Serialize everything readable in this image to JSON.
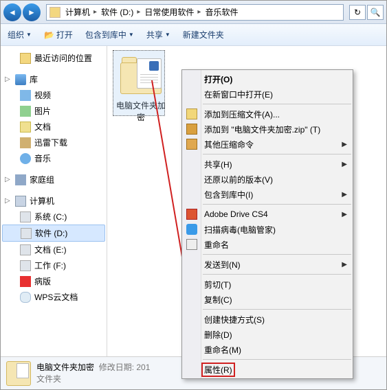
{
  "nav": {
    "crumbs": [
      "计算机",
      "软件 (D:)",
      "日常使用软件",
      "音乐软件"
    ]
  },
  "toolbar": {
    "organize": "组织",
    "open": "打开",
    "include": "包含到库中",
    "share": "共享",
    "newfolder": "新建文件夹"
  },
  "sidebar": {
    "recent": "最近访问的位置",
    "library": "库",
    "video": "视频",
    "pictures": "图片",
    "documents": "文档",
    "download": "迅雷下载",
    "music": "音乐",
    "homegroup": "家庭组",
    "computer": "计算机",
    "sys": "系统 (C:)",
    "soft": "软件 (D:)",
    "doc2": "文档 (E:)",
    "work": "工作 (F:)",
    "redacted": "病版",
    "wps": "WPS云文档"
  },
  "file": {
    "name": "电脑文件夹加密"
  },
  "ctx": {
    "open": "打开(O)",
    "newwin": "在新窗口中打开(E)",
    "addcomp": "添加到压缩文件(A)...",
    "addzip": "添加到 \"电脑文件夹加密.zip\" (T)",
    "otherzip": "其他压缩命令",
    "share": "共享(H)",
    "restore": "还原以前的版本(V)",
    "include": "包含到库中(I)",
    "adobe": "Adobe Drive CS4",
    "scan": "扫描病毒(电脑管家)",
    "rename2": "重命名",
    "sendto": "发送到(N)",
    "cut": "剪切(T)",
    "copy": "复制(C)",
    "shortcut": "创建快捷方式(S)",
    "delete": "删除(D)",
    "rename": "重命名(M)",
    "properties": "属性(R)"
  },
  "status": {
    "name": "电脑文件夹加密",
    "modlabel": "修改日期:",
    "modval": "201",
    "type": "文件夹"
  }
}
